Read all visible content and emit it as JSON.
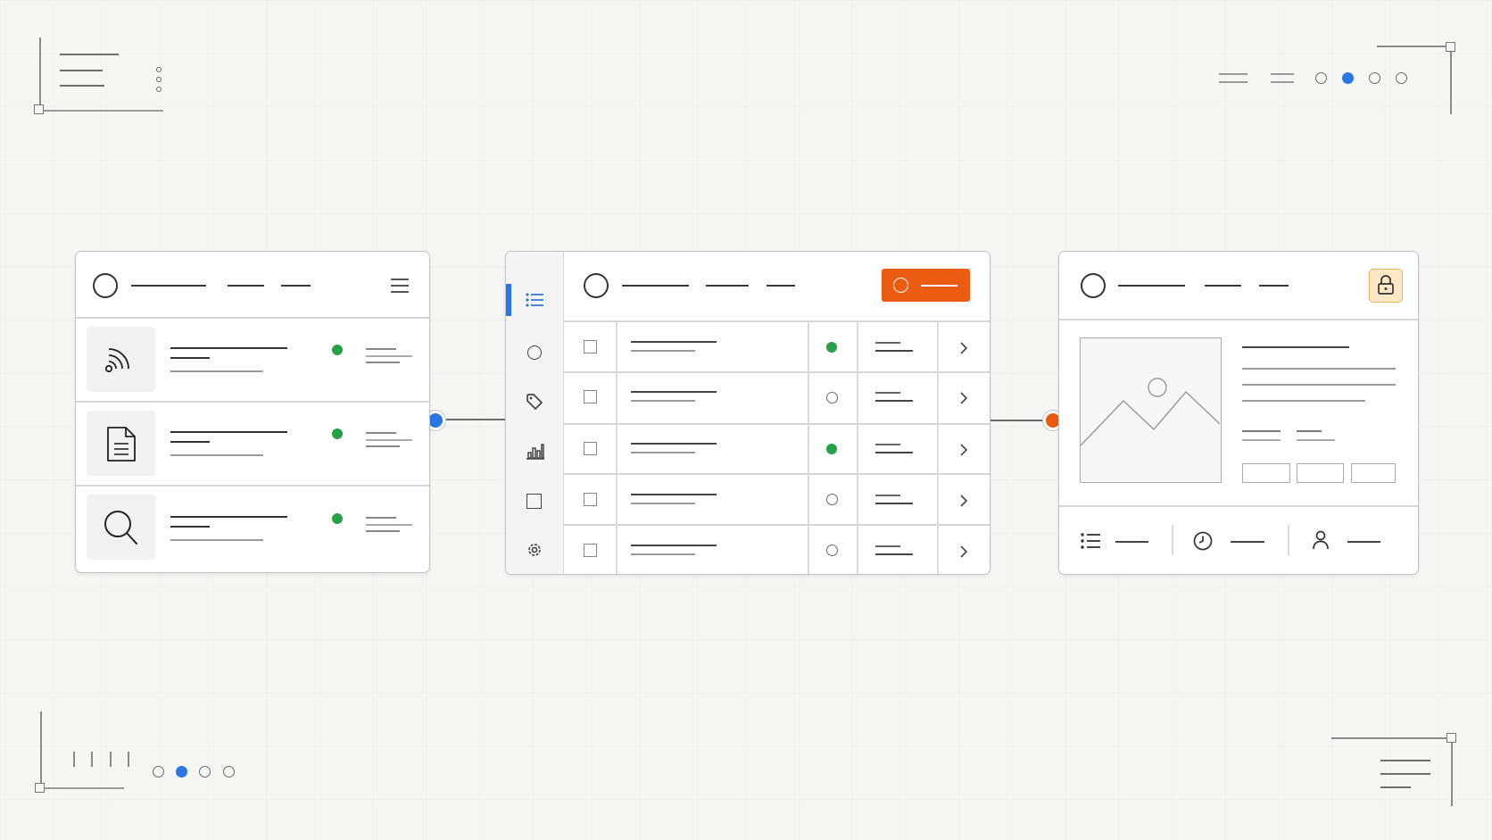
{
  "colors": {
    "background": "#f6f6f5",
    "accent_blue": "#2a76e4",
    "accent_orange": "#ec5b12",
    "status_green": "#27a047",
    "lock_badge_bg": "#fde7c4",
    "lock_badge_border": "#eab36a",
    "line_dark": "#3a3a3a",
    "line_light": "#9a9a9a",
    "panel_border": "#c3c3c3"
  },
  "corner_decor": {
    "top_right_pager": {
      "count": 4,
      "active_index": 1
    },
    "bottom_left_pager": {
      "count": 4,
      "active_index": 1
    }
  },
  "left_panel": {
    "header_icons": [
      "circle-icon",
      "hamburger-menu-icon"
    ],
    "rows": [
      {
        "icon": "rss-feed-icon",
        "status": "green"
      },
      {
        "icon": "document-icon",
        "status": "green"
      },
      {
        "icon": "search-icon",
        "status": "green"
      }
    ]
  },
  "middle_panel": {
    "sidebar_icons": [
      "list-icon",
      "circle-icon",
      "tag-icon",
      "bar-chart-icon",
      "square-icon",
      "gear-icon"
    ],
    "active_sidebar_index": 0,
    "header_action": {
      "icon": "circle-icon",
      "color": "orange"
    },
    "rows": [
      {
        "status": "filled-green"
      },
      {
        "status": "empty-circle"
      },
      {
        "status": "filled-green"
      },
      {
        "status": "empty-circle"
      },
      {
        "status": "empty-circle"
      }
    ]
  },
  "right_panel": {
    "header_icons": [
      "circle-icon",
      "lock-icon"
    ],
    "media": "image-placeholder-icon",
    "buttons_count": 3,
    "footer_icons": [
      "list-icon",
      "clock-icon",
      "user-icon"
    ]
  },
  "connectors": {
    "left_to_middle_node": "blue",
    "middle_to_right_node": "orange"
  }
}
